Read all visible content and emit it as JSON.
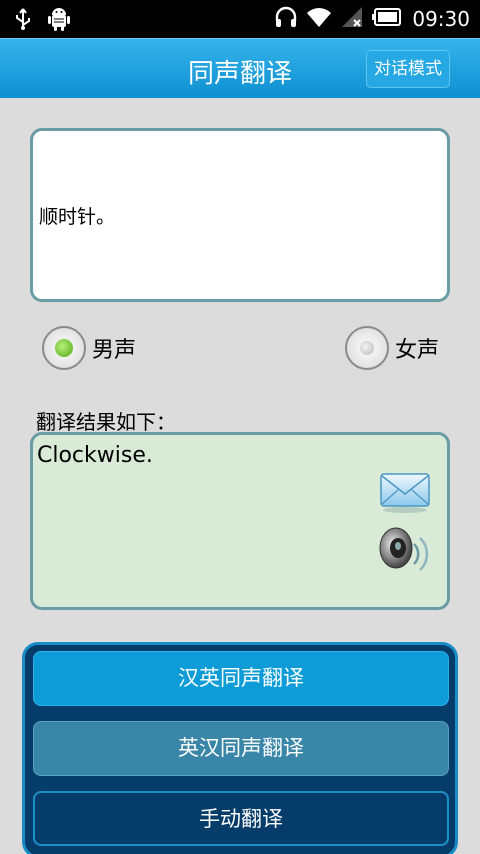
{
  "status_bar": {
    "time": "09:30",
    "icons": [
      "usb-icon",
      "android-debug-icon",
      "headphones-icon",
      "wifi-icon",
      "signal-icon",
      "battery-icon"
    ]
  },
  "title_bar": {
    "title": "同声翻译",
    "dialog_mode_label": "对话模式"
  },
  "input": {
    "text": "顺时针。"
  },
  "voice": {
    "options": [
      {
        "label": "男声",
        "selected": true
      },
      {
        "label": "女声",
        "selected": false
      }
    ]
  },
  "result": {
    "label": "翻译结果如下：",
    "text": "Clockwise.",
    "icons": [
      "mail-icon",
      "speaker-icon"
    ]
  },
  "panel": {
    "buttons": [
      {
        "label": "汉英同声翻译"
      },
      {
        "label": "英汉同声翻译"
      },
      {
        "label": "手动翻译"
      }
    ]
  },
  "colors": {
    "title_bar": "#1aa0de",
    "result_bg": "#d9ead7",
    "panel_bg": "#063c6a",
    "box_border": "#6a9ca5"
  }
}
